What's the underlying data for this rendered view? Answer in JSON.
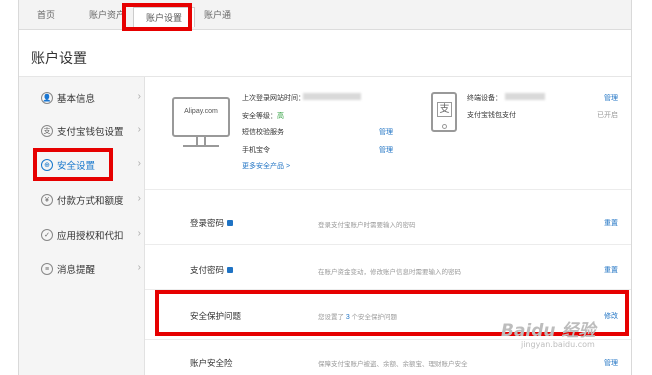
{
  "topnav": {
    "tabs": [
      {
        "label": "首页"
      },
      {
        "label": "账户资产"
      },
      {
        "label": "账户设置",
        "active": true
      },
      {
        "label": "账户通"
      }
    ]
  },
  "page": {
    "title": "账户设置"
  },
  "sidebar": {
    "items": [
      {
        "label": "基本信息",
        "icon": "user-icon",
        "glyph": "👤"
      },
      {
        "label": "支付宝钱包设置",
        "icon": "wallet-icon",
        "glyph": "支"
      },
      {
        "label": "安全设置",
        "icon": "shield-icon",
        "glyph": "⊕",
        "active": true
      },
      {
        "label": "付款方式和额度",
        "icon": "yuan-icon",
        "glyph": "¥"
      },
      {
        "label": "应用授权和代扣",
        "icon": "check-icon",
        "glyph": "✓"
      },
      {
        "label": "消息提醒",
        "icon": "message-icon",
        "glyph": "≡"
      }
    ],
    "chevron": "›"
  },
  "security_overview": {
    "monitor_text": "Alipay.com",
    "last_login_label": "上次登录网站时间：",
    "security_level_label": "安全等级：",
    "security_level_value": "高",
    "sms_service_label": "短信校验服务",
    "sms_service_action": "管理",
    "phone_token_label": "手机宝令",
    "phone_token_action": "管理",
    "more_products_link": "更多安全产品 >",
    "device_label": "终端设备：",
    "device_action": "管理",
    "wallet_payment_label": "支付宝钱包支付",
    "wallet_payment_status": "已开启",
    "phone_glyph": "支"
  },
  "security_rows": [
    {
      "label": "登录密码",
      "description": "登录支付宝账户时需要输入的密码",
      "action": "重置"
    },
    {
      "label": "支付密码",
      "description": "在账户资金变动，修改账户信息时需要输入的密码",
      "action": "重置"
    },
    {
      "label": "安全保护问题",
      "description_pre": "您设置了",
      "description_num": "3",
      "description_post": "个安全保护问题",
      "action": "修改"
    },
    {
      "label": "账户安全险",
      "description": "保障支付宝账户被盗、余额、余额宝、理财账户安全",
      "action": "管理"
    }
  ],
  "watermark": {
    "brand": "Baidu 经验",
    "url": "jingyan.baidu.com"
  },
  "colors": {
    "highlight": "#e60000",
    "link": "#1f73c4",
    "active": "#1677cc"
  }
}
